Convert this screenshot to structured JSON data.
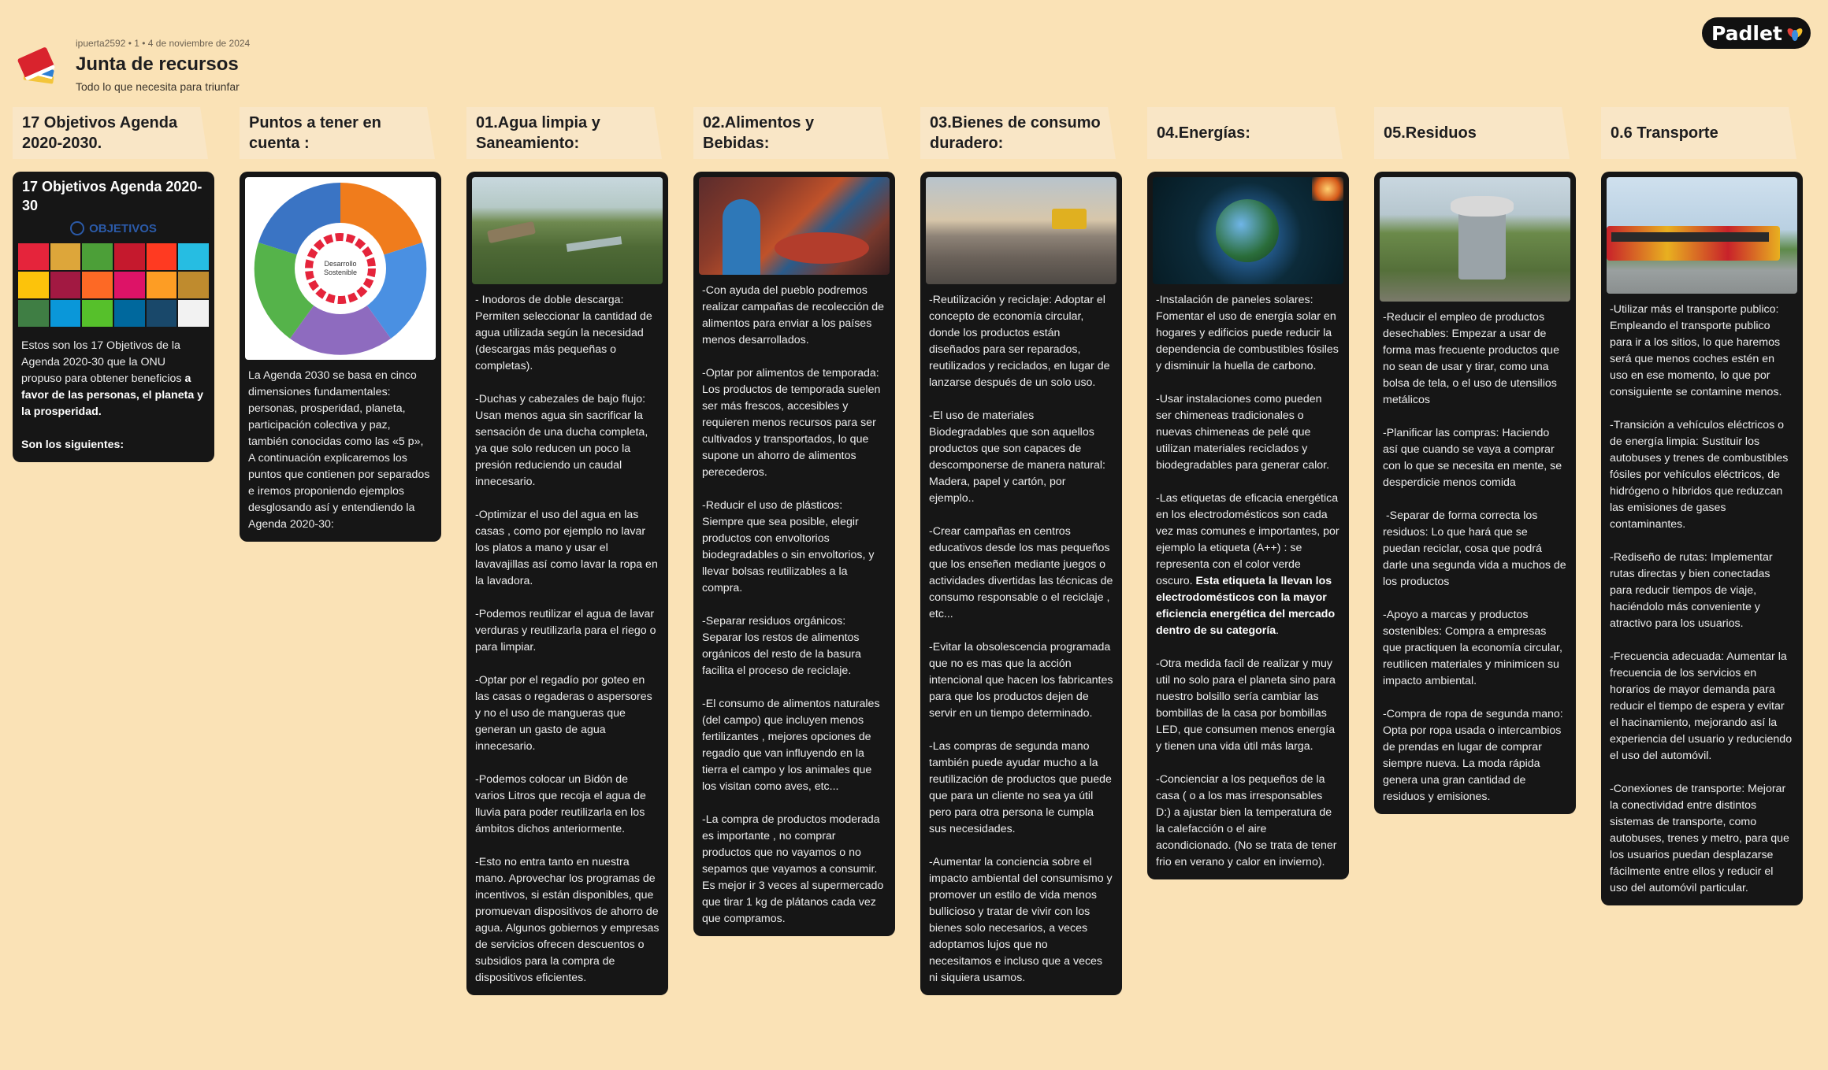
{
  "header": {
    "meta": "ipuerta2592 • 1 • 4 de noviembre de 2024",
    "title": "Junta de recursos",
    "subtitle": "Todo lo que necesita para triunfar",
    "logo": "Padlet",
    "icon": "book-stack-icon"
  },
  "colors": {
    "background": "#fae2b6",
    "card": "#161616",
    "section": "#f9e6c6"
  },
  "sections": [
    {
      "title": "17 Objetivos Agenda 2020-2030.",
      "card_title": "17 Objetivos Agenda 2020-30",
      "image_banner": "OBJETIVOS",
      "body": "Estos son los 17 Objetivos de la Agenda 2020-30 que la ONU propuso para obtener beneficios ",
      "body_bold": "a favor de las personas, el planeta y la prosperidad.",
      "body_bold2": "Son los siguientes:"
    },
    {
      "title": "Puntos a tener en cuenta :",
      "image_center": "Desarrollo Sostenible",
      "body": "La Agenda 2030 se basa en cinco dimensiones fundamentales: personas, prosperidad, planeta, participación colectiva y paz, también conocidas como las «5 p», A continuación explicaremos los puntos que contienen por separados e iremos proponiendo ejemplos desglosando así y entendiendo la Agenda 2020-30:"
    },
    {
      "title": "01.Agua limpia y Saneamiento:",
      "body": "- Inodoros de doble descarga: Permiten seleccionar la cantidad de agua utilizada según la necesidad (descargas más pequeñas o completas).\n\n-Duchas y cabezales de bajo flujo: Usan menos agua sin sacrificar la sensación de una ducha completa, ya que solo reducen un poco la presión reduciendo un caudal innecesario.\n\n-Optimizar el uso del agua en las casas , como por ejemplo no lavar los platos a mano y usar el lavavajillas así como lavar la ropa en la lavadora.\n\n-Podemos reutilizar el agua de lavar verduras y reutilizarla para el riego o para limpiar.\n\n-Optar por el regadío por goteo en las casas o regaderas o aspersores y no el uso de mangueras que generan un gasto de agua innecesario.\n\n-Podemos colocar un Bidón de varios Litros que recoja el agua de lluvia para poder reutilizarla en los ámbitos dichos anteriormente.\n\n-Esto no entra tanto en nuestra mano. Aprovechar los programas de incentivos, si están disponibles, que promuevan dispositivos de ahorro de agua. Algunos gobiernos y empresas de servicios ofrecen descuentos o subsidios para la compra de dispositivos eficientes."
    },
    {
      "title": "02.Alimentos y Bebidas:",
      "body": "-Con ayuda del pueblo podremos realizar campañas de recolección de alimentos para enviar a los países menos desarrollados.\n\n-Optar por alimentos de temporada: Los productos de temporada suelen ser más frescos, accesibles y requieren menos recursos para ser cultivados y transportados, lo que supone un ahorro de alimentos perecederos.\n\n-Reducir el uso de plásticos: Siempre que sea posible, elegir productos con envoltorios biodegradables o sin envoltorios, y llevar bolsas reutilizables a la compra.\n\n-Separar residuos orgánicos: Separar los restos de alimentos orgánicos del resto de la basura facilita el proceso de reciclaje.\n\n-El consumo de alimentos naturales (del campo) que incluyen menos fertilizantes , mejores opciones de regadío que van influyendo en la tierra el campo y los animales que los visitan como aves, etc...\n\n-La compra de productos moderada es importante , no comprar productos que no vayamos o no sepamos que vayamos a consumir. Es mejor ir 3 veces al supermercado que tirar 1 kg de plátanos cada vez que compramos."
    },
    {
      "title": "03.Bienes de consumo duradero:",
      "body": "-Reutilización y reciclaje: Adoptar el concepto de economía circular, donde los productos están diseñados para ser reparados, reutilizados y reciclados, en lugar de lanzarse después de un solo uso.\n\n-El uso de materiales Biodegradables que son aquellos productos que son capaces de descomponerse de manera natural: Madera, papel y cartón, por ejemplo..\n\n-Crear campañas en centros educativos desde los mas pequeños que los enseñen mediante juegos o actividades divertidas las técnicas de consumo responsable o el reciclaje , etc...\n\n-Evitar la obsolescencia programada que no es mas que la acción intencional que hacen los fabricantes para que los productos dejen de servir en un tiempo determinado.\n\n-Las compras de segunda mano también puede ayudar mucho a la reutilización de productos que puede que para un cliente no sea ya útil pero para otra persona le cumpla sus necesidades.\n\n-Aumentar la conciencia sobre el impacto ambiental del consumismo y promover un estilo de vida menos bullicioso y tratar de vivir con los bienes solo necesarios, a veces adoptamos lujos que no necesitamos e incluso que a veces ni siquiera usamos."
    },
    {
      "title": "04.Energías:",
      "body": "-Instalación de paneles solares: Fomentar el uso de energía solar en hogares y edificios puede reducir la dependencia de combustibles fósiles y disminuir la huella de carbono.\n\n-Usar instalaciones como pueden ser chimeneas tradicionales o nuevas chimeneas de pelé que utilizan materiales reciclados y biodegradables para generar calor.\n\n-Las etiquetas de eficacia energética en los electrodomésticos son cada vez mas comunes e importantes, por ejemplo la etiqueta (A++) : se representa con el color verde oscuro. ",
      "body_bold": "Esta etiqueta la llevan los electrodomésticos con la mayor eficiencia energética del mercado dentro de su categoría",
      "body_after": ".\n\n-Otra medida facil de realizar y muy util no solo para el planeta sino para nuestro bolsillo sería cambiar las bombillas de la casa por bombillas LED, que consumen menos energía y tienen una vida útil más larga.\n\n-Concienciar a los pequeños de la casa ( o a los mas irresponsables D:) a ajustar bien la temperatura de la calefacción o el aire acondicionado. (No se trata de tener frio en verano y calor en invierno)."
    },
    {
      "title": "05.Residuos",
      "body": "-Reducir el empleo de productos desechables: Empezar a usar de forma mas frecuente productos que no sean de usar y tirar, como una bolsa de tela, o el uso de utensilios metálicos\n\n-Planificar las compras: Haciendo así que cuando se vaya a comprar con lo que se necesita en mente, se desperdicie menos comida\n\n -Separar de forma correcta los residuos: Lo que hará que se puedan reciclar, cosa que podrá darle una segunda vida a muchos de los productos\n\n-Apoyo a marcas y productos sostenibles: Compra a empresas que practiquen la economía circular, reutilicen materiales y minimicen su impacto ambiental.\n\n-Compra de ropa de segunda mano: Opta por ropa usada o intercambios de prendas en lugar de comprar siempre nueva. La moda rápida genera una gran cantidad de residuos y emisiones."
    },
    {
      "title": "0.6 Transporte",
      "body": "-Utilizar más el transporte publico: Empleando el transporte publico para ir a los sitios, lo que haremos será que menos coches estén en uso en ese momento, lo que por consiguiente se contamine menos.\n\n-Transición a vehículos eléctricos o de energía limpia: Sustituir los autobuses y trenes de combustibles fósiles por vehículos eléctricos, de hidrógeno o híbridos que reduzcan las emisiones de gases contaminantes.\n\n-Rediseño de rutas: Implementar rutas directas y bien conectadas para reducir tiempos de viaje, haciéndolo más conveniente y atractivo para los usuarios.\n\n-Frecuencia adecuada: Aumentar la frecuencia de los servicios en horarios de mayor demanda para reducir el tiempo de espera y evitar el hacinamiento, mejorando así la experiencia del usuario y reduciendo el uso del automóvil.\n\n-Conexiones de transporte: Mejorar la conectividad entre distintos sistemas de transporte, como autobuses, trenes y metro, para que los usuarios puedan desplazarse fácilmente entre ellos y reducir el uso del automóvil particular."
    }
  ]
}
